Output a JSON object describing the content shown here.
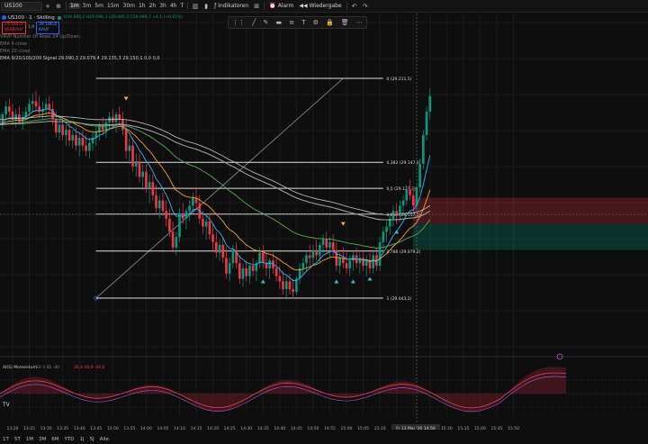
{
  "toolbar": {
    "symbol": "US100",
    "intervals": [
      {
        "label": "1m",
        "active": true
      },
      {
        "label": "3m",
        "active": false
      },
      {
        "label": "5m",
        "active": false
      },
      {
        "label": "15m",
        "active": false
      },
      {
        "label": "30m",
        "active": false
      },
      {
        "label": "1h",
        "active": false
      },
      {
        "label": "2h",
        "active": false
      },
      {
        "label": "3h",
        "active": false
      },
      {
        "label": "4h",
        "active": false
      },
      {
        "label": "T",
        "active": false
      }
    ],
    "indicators_label": "Indikatoren",
    "alarm_label": "Alarm",
    "replay_label": "Wiedergabe"
  },
  "legend": {
    "title": "US100 · 1 · Skilling",
    "ohlc": "O29.085,2 H29.096,3 L29.085,2 C29.089,7 +4,1 (+0,01%)",
    "sell_price": "29.184,9",
    "sell_label": "VERKAUF",
    "spread": "1,9",
    "buy_price": "29.186,8",
    "buy_label": "KAUF",
    "vrvp": "VRVP Number Of Rows 24 Up/Down",
    "ema_a": "EMA 9 close",
    "ema_b": "EMA 20 close",
    "ema_line": "EMA 9/20/100/200 Signal 29.090,3 29.079,4 29.135,3 29.150,1 0,0 0,0"
  },
  "price_axis": {
    "labels": [],
    "current_price": "",
    "current_color": "#089981"
  },
  "fib": {
    "levels": [
      {
        "ratio": "0",
        "price": "(29.211,5)"
      },
      {
        "ratio": "0,382",
        "price": "(29.147,2)"
      },
      {
        "ratio": "0,5",
        "price": "(29.127,3)"
      },
      {
        "ratio": "0,618",
        "price": "(29.107,5)"
      },
      {
        "ratio": "0,786",
        "price": "(29.079,2)"
      },
      {
        "ratio": "1",
        "price": "(29.043,2)"
      }
    ]
  },
  "time_axis": {
    "labels": [
      "13:20",
      "13:25",
      "13:30",
      "13:35",
      "13:40",
      "13:45",
      "13:50",
      "13:55",
      "14:00",
      "14:05",
      "14:10",
      "14:15",
      "14:20",
      "14:25",
      "14:30",
      "14:35",
      "14:40",
      "14:45",
      "14:50",
      "14:55",
      "15:00",
      "15:05",
      "15:10",
      "15:15",
      "15:20",
      "15:25",
      "15:30",
      "15:35",
      "15:40",
      "15:45",
      "15:50"
    ],
    "cursor_label": "Fr 13 Mai '26   14:56"
  },
  "oscillator": {
    "title": "AI(S) Momentum",
    "params": "10 3 40 -40",
    "values": "26,4  40,0  -40,0",
    "labels": []
  },
  "range": [
    "1T",
    "5T",
    "1M",
    "3M",
    "6M",
    "YTD",
    "1J",
    "5J",
    "Alle"
  ],
  "logo": "TV",
  "colors": {
    "up": "#089981",
    "down": "#f23645",
    "ema_fast": "#29b6f6",
    "ema_mid": "#f7a21b",
    "ema_slow": "#4caf50",
    "ema_200": "#9e9e9e",
    "fib": "#e0e0e0"
  }
}
